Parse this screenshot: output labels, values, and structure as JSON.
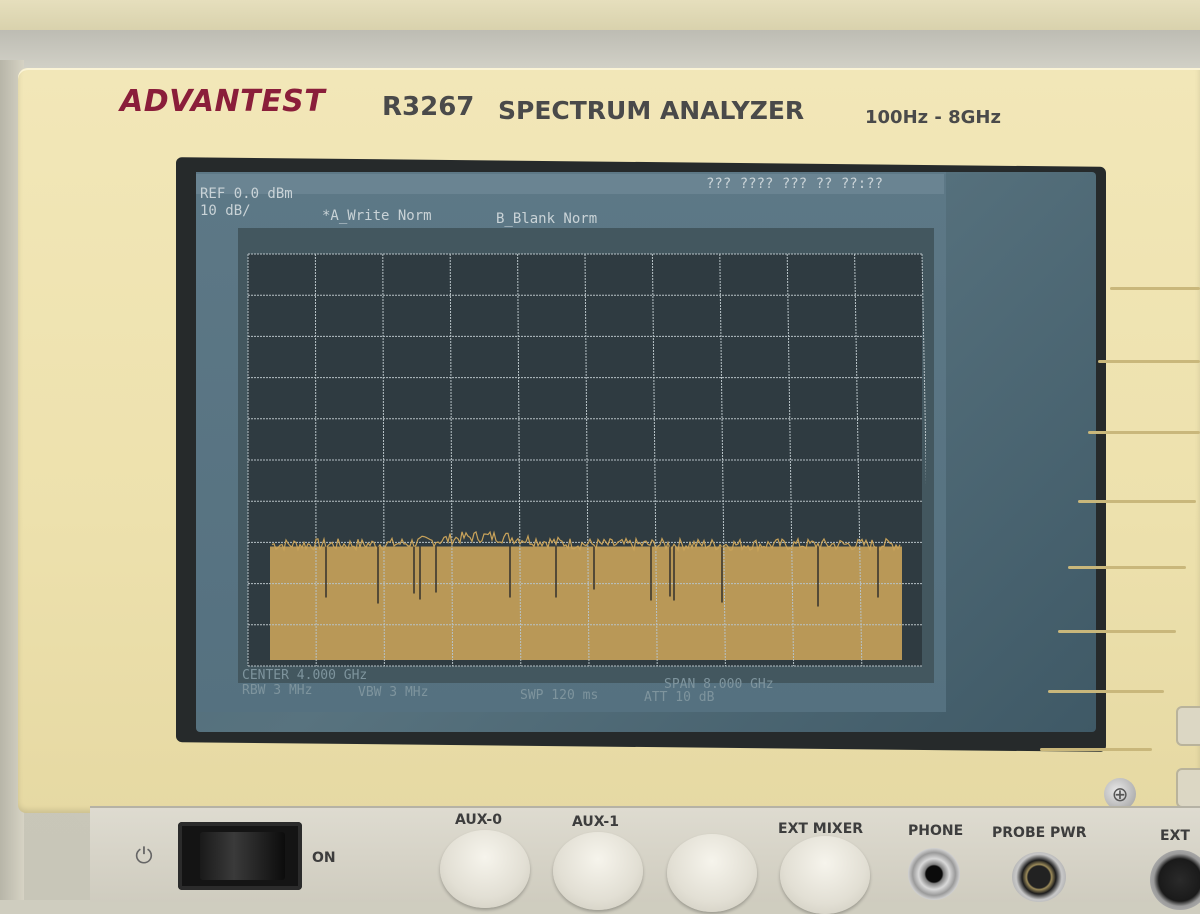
{
  "instrument": {
    "brand": "ADVANTEST",
    "model": "R3267",
    "title": "SPECTRUM ANALYZER",
    "frequency_range": "100Hz - 8GHz"
  },
  "screen": {
    "datetime": "??? ???? ??? ?? ??:??",
    "ref_level": "REF 0.0 dBm",
    "scale": "10 dB/",
    "trace_a": "*A_Write Norm",
    "trace_b": "B_Blank Norm",
    "center": "CENTER 4.000 GHz",
    "span": "SPAN 8.000 GHz",
    "rbw": "RBW 3 MHz",
    "vbw": "VBW 3 MHz",
    "sweep": "SWP 120 ms",
    "attenuation": "ATT 10 dB"
  },
  "panel": {
    "power_label": "ON",
    "aux0": "AUX-0",
    "aux1": "AUX-1",
    "ext_mixer": "EXT MIXER",
    "phone": "PHONE",
    "probe_pwr": "PROBE PWR",
    "ext": "EXT"
  },
  "colors": {
    "brand": "#8a1e3a",
    "trace": "#c9a35a",
    "graticule": "#b7c2c6"
  },
  "icons": [
    "power-icon",
    "screw-icon"
  ]
}
